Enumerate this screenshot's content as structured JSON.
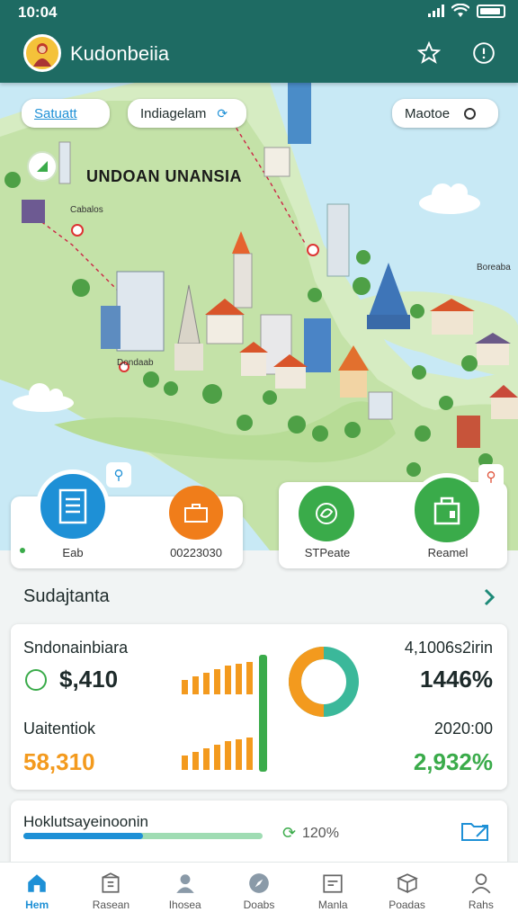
{
  "status": {
    "time": "10:04"
  },
  "app": {
    "title": "Kudonbeiia"
  },
  "map": {
    "chips": {
      "left": "Satuatt",
      "middle": "Indiagelam",
      "right": "Maotoe"
    },
    "title": "UNDOAN UNANSIA",
    "labels": {
      "city_a": "Cabalos",
      "city_b": "Dondaab",
      "right": "Boreaba"
    }
  },
  "actions": [
    {
      "label": "Eab",
      "color": "#1e90d6",
      "icon": "document-icon"
    },
    {
      "label": "00223030",
      "color": "#f07d1a",
      "icon": "briefcase-icon"
    },
    {
      "label": "STPeate",
      "color": "#3aab4a",
      "icon": "leaf-icon"
    },
    {
      "label": "Reamel",
      "color": "#3aab4a",
      "icon": "bag-icon"
    }
  ],
  "section": {
    "title": "Sudajtanta"
  },
  "stats": {
    "row1": {
      "label": "Sndonainbiara",
      "value": "$,410",
      "right_label": "4,1006s2irin",
      "right_value": "1446%"
    },
    "row2": {
      "label": "Uaitentiok",
      "value": "58,310",
      "right_label": "2020:00",
      "right_value": "2,932%"
    },
    "bars_top": [
      1,
      1,
      1,
      1,
      1,
      1,
      1
    ],
    "donut": {
      "primary_fraction": 0.5,
      "primary_color": "#f39a1e",
      "secondary_color": "#3bb89a"
    }
  },
  "progress": {
    "label": "Hoklutsayeinoonin",
    "percent_text": "120%",
    "fraction": 0.5
  },
  "nav": [
    {
      "label": "Hem",
      "active": true
    },
    {
      "label": "Rasean"
    },
    {
      "label": "Ihosea"
    },
    {
      "label": "Doabs"
    },
    {
      "label": "Manla"
    },
    {
      "label": "Poadas"
    },
    {
      "label": "Rahs"
    }
  ],
  "colors": {
    "appbar": "#1e6b63",
    "accent": "#1e90d6",
    "orange": "#f39a1e",
    "green": "#3aab4a"
  }
}
